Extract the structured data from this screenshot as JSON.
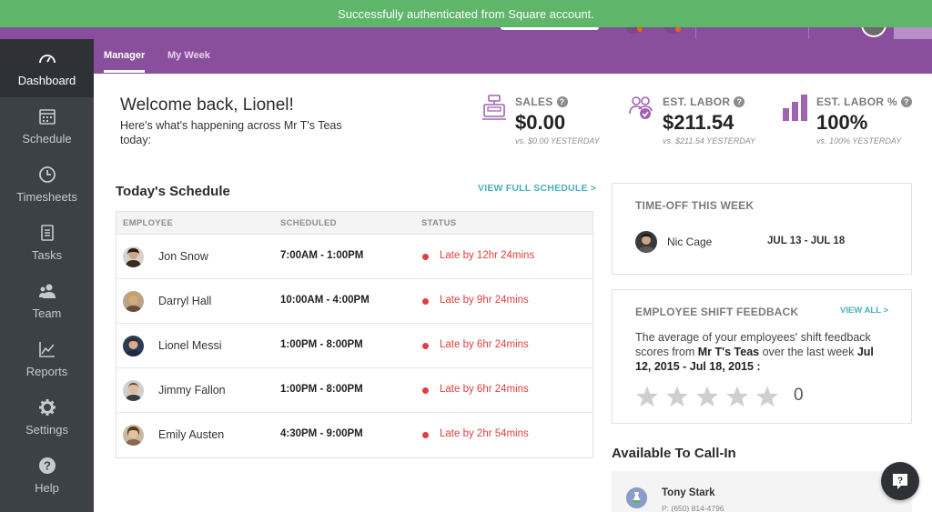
{
  "toast": {
    "message": "Successfully authenticated from Square account."
  },
  "sidebar": {
    "items": [
      {
        "label": "Dashboard",
        "icon": "speedometer-icon"
      },
      {
        "label": "Schedule",
        "icon": "calendar-icon"
      },
      {
        "label": "Timesheets",
        "icon": "clock-icon"
      },
      {
        "label": "Tasks",
        "icon": "checklist-icon"
      },
      {
        "label": "Team",
        "icon": "team-icon"
      },
      {
        "label": "Reports",
        "icon": "line-chart-icon"
      },
      {
        "label": "Settings",
        "icon": "gear-icon"
      },
      {
        "label": "Help",
        "icon": "help-icon"
      }
    ]
  },
  "subnav": {
    "tabs": [
      {
        "label": "Manager"
      },
      {
        "label": "My Week"
      }
    ]
  },
  "welcome": {
    "title": "Welcome back, Lionel!",
    "subtitle": "Here's what's happening across Mr T's Teas today:"
  },
  "stats": {
    "sales": {
      "title": "SALES",
      "value": "$0.00",
      "compare": "vs. $0.00 YESTERDAY",
      "icon": "cash-register-icon"
    },
    "labor": {
      "title": "EST. LABOR",
      "value": "$211.54",
      "compare": "vs. $211.54 YESTERDAY",
      "icon": "people-icon"
    },
    "labor_pct": {
      "title": "EST. LABOR %",
      "value": "100%",
      "compare": "vs. 100% YESTERDAY",
      "icon": "bar-chart-icon"
    }
  },
  "schedule": {
    "title": "Today's Schedule",
    "view_link": "VIEW FULL SCHEDULE >",
    "columns": [
      "EMPLOYEE",
      "SCHEDULED",
      "STATUS"
    ],
    "rows": [
      {
        "name": "Jon Snow",
        "time": "7:00AM - 1:00PM",
        "status": "Late by 12hr 24mins"
      },
      {
        "name": "Darryl Hall",
        "time": "10:00AM - 4:00PM",
        "status": "Late by 9hr 24mins"
      },
      {
        "name": "Lionel Messi",
        "time": "1:00PM - 8:00PM",
        "status": "Late by 6hr 24mins"
      },
      {
        "name": "Jimmy Fallon",
        "time": "1:00PM - 8:00PM",
        "status": "Late by 6hr 24mins"
      },
      {
        "name": "Emily Austen",
        "time": "4:30PM - 9:00PM",
        "status": "Late by 2hr 54mins"
      }
    ],
    "status_color": "#e03e3e"
  },
  "timeoff": {
    "title": "TIME-OFF THIS WEEK",
    "name": "Nic Cage",
    "dates": "JUL 13 - JUL 18"
  },
  "feedback": {
    "title": "EMPLOYEE SHIFT FEEDBACK",
    "view_all": "VIEW ALL >",
    "text_1": "The average of your employees' shift feedback scores from ",
    "location": "Mr T's Teas",
    "text_2": " over the last week ",
    "range": "Jul 12, 2015 - Jul 18, 2015 :",
    "stars_filled": 0,
    "stars_total": 5,
    "score": "0"
  },
  "callin": {
    "title": "Available To Call-In",
    "name": "Tony Stark",
    "phone": "P: (650) 814-4796"
  },
  "colors": {
    "brand": "#8a4f9c",
    "accent": "#4bb0c0",
    "toast": "#5fb56a",
    "sidebar": "#3c4147"
  }
}
